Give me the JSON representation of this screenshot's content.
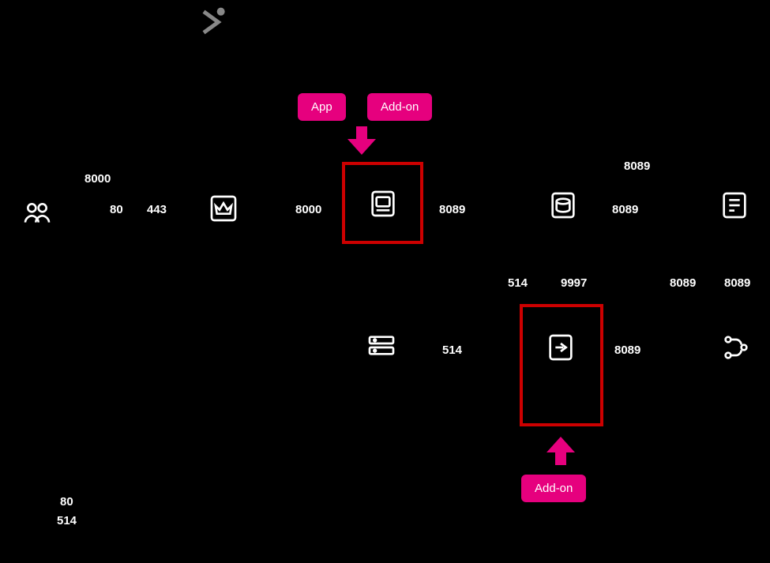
{
  "ports": {
    "p8000_top": "8000",
    "p80": "80",
    "p443": "443",
    "p8000_mid": "8000",
    "p8089_top": "8089",
    "p8089_r1": "8089",
    "p8089_r2": "8089",
    "p514_top": "514",
    "p9997": "9997",
    "p8089_b1": "8089",
    "p8089_b2": "8089",
    "p514_mid": "514",
    "p8089_b3": "8089",
    "p80_bottom": "80",
    "p514_bottom": "514"
  },
  "tags": {
    "app": "App",
    "addon1": "Add-on",
    "addon2": "Add-on"
  }
}
